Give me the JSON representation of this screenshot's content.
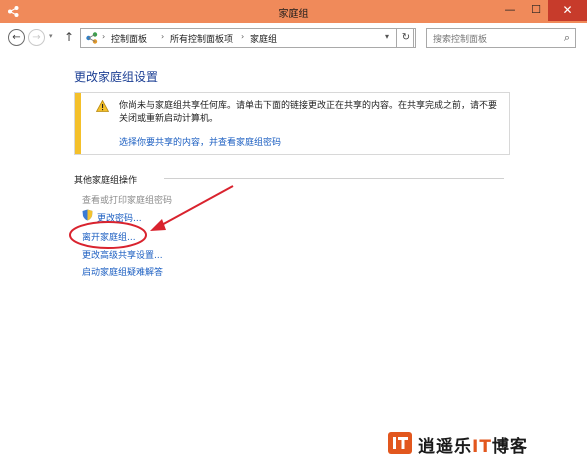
{
  "window": {
    "title": "家庭组",
    "controls": {
      "minimize": "—",
      "maximize": "☐",
      "close": "✕"
    },
    "accent_color": "#f08a5a"
  },
  "nav": {
    "back_glyph": "←",
    "forward_glyph": "→",
    "up_glyph": "↑",
    "dropdown_glyph": "▾",
    "breadcrumb": [
      "控制面板",
      "所有控制面板项",
      "家庭组"
    ],
    "breadcrumb_sep": "›",
    "address_dropdown_glyph": "▾",
    "refresh_glyph": "↻",
    "search_placeholder": "搜索控制面板",
    "search_glyph": "⌕"
  },
  "main": {
    "title": "更改家庭组设置",
    "alert": {
      "text": "你尚未与家庭组共享任何库。请单击下面的链接更改正在共享的内容。在共享完成之前，请不要关闭或重新启动计算机。",
      "link": "选择你要共享的内容，并查看家庭组密码",
      "stripe_color": "#f4c02a"
    },
    "section_title": "其他家庭组操作",
    "actions": [
      {
        "label": "查看或打印家庭组密码",
        "enabled": false
      },
      {
        "label": "更改密码...",
        "enabled": true
      },
      {
        "label": "离开家庭组...",
        "enabled": true
      },
      {
        "label": "更改高级共享设置...",
        "enabled": true
      },
      {
        "label": "启动家庭组疑难解答",
        "enabled": true
      }
    ],
    "link_color": "#1c5fc2"
  },
  "watermark": {
    "prefix": "逍遥乐",
    "it": "IT",
    "suffix": "博客",
    "accent": "#e2571e"
  }
}
